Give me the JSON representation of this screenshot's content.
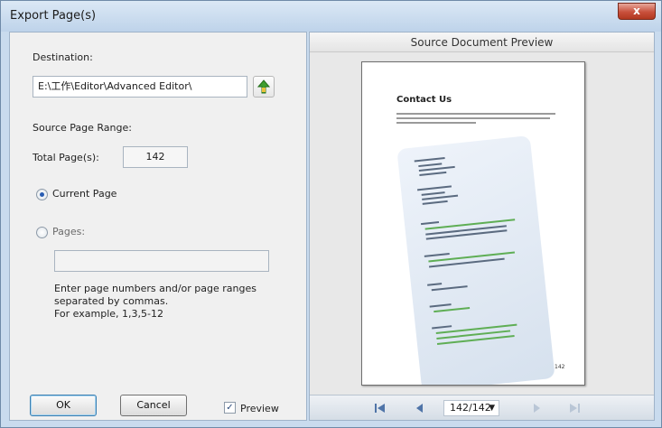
{
  "window": {
    "title": "Export Page(s)",
    "close_label": "x"
  },
  "left": {
    "destination_label": "Destination:",
    "destination_value": "E:\\工作\\Editor\\Advanced Editor\\",
    "source_range_label": "Source Page Range:",
    "total_pages_label": "Total Page(s):",
    "total_pages_value": "142",
    "current_page_label": "Current Page",
    "pages_label": "Pages:",
    "pages_value": "",
    "hint_lines": [
      "Enter page numbers and/or page ranges",
      "separated by commas.",
      "For example, 1,3,5-12"
    ],
    "ok_label": "OK",
    "cancel_label": "Cancel",
    "preview_label": "Preview",
    "preview_checked": true
  },
  "right": {
    "title": "Source Document Preview",
    "doc_heading": "Contact Us",
    "doc_page_number": "142",
    "page_indicator": "142/142"
  },
  "colors": {
    "accent": "#2a5db3",
    "panel": "#f0f0f0",
    "frame": "#c9dbee"
  },
  "icons": [
    "upload-arrow-icon",
    "first-page-icon",
    "prev-page-icon",
    "next-page-icon",
    "last-page-icon",
    "dropdown-arrow-icon"
  ]
}
